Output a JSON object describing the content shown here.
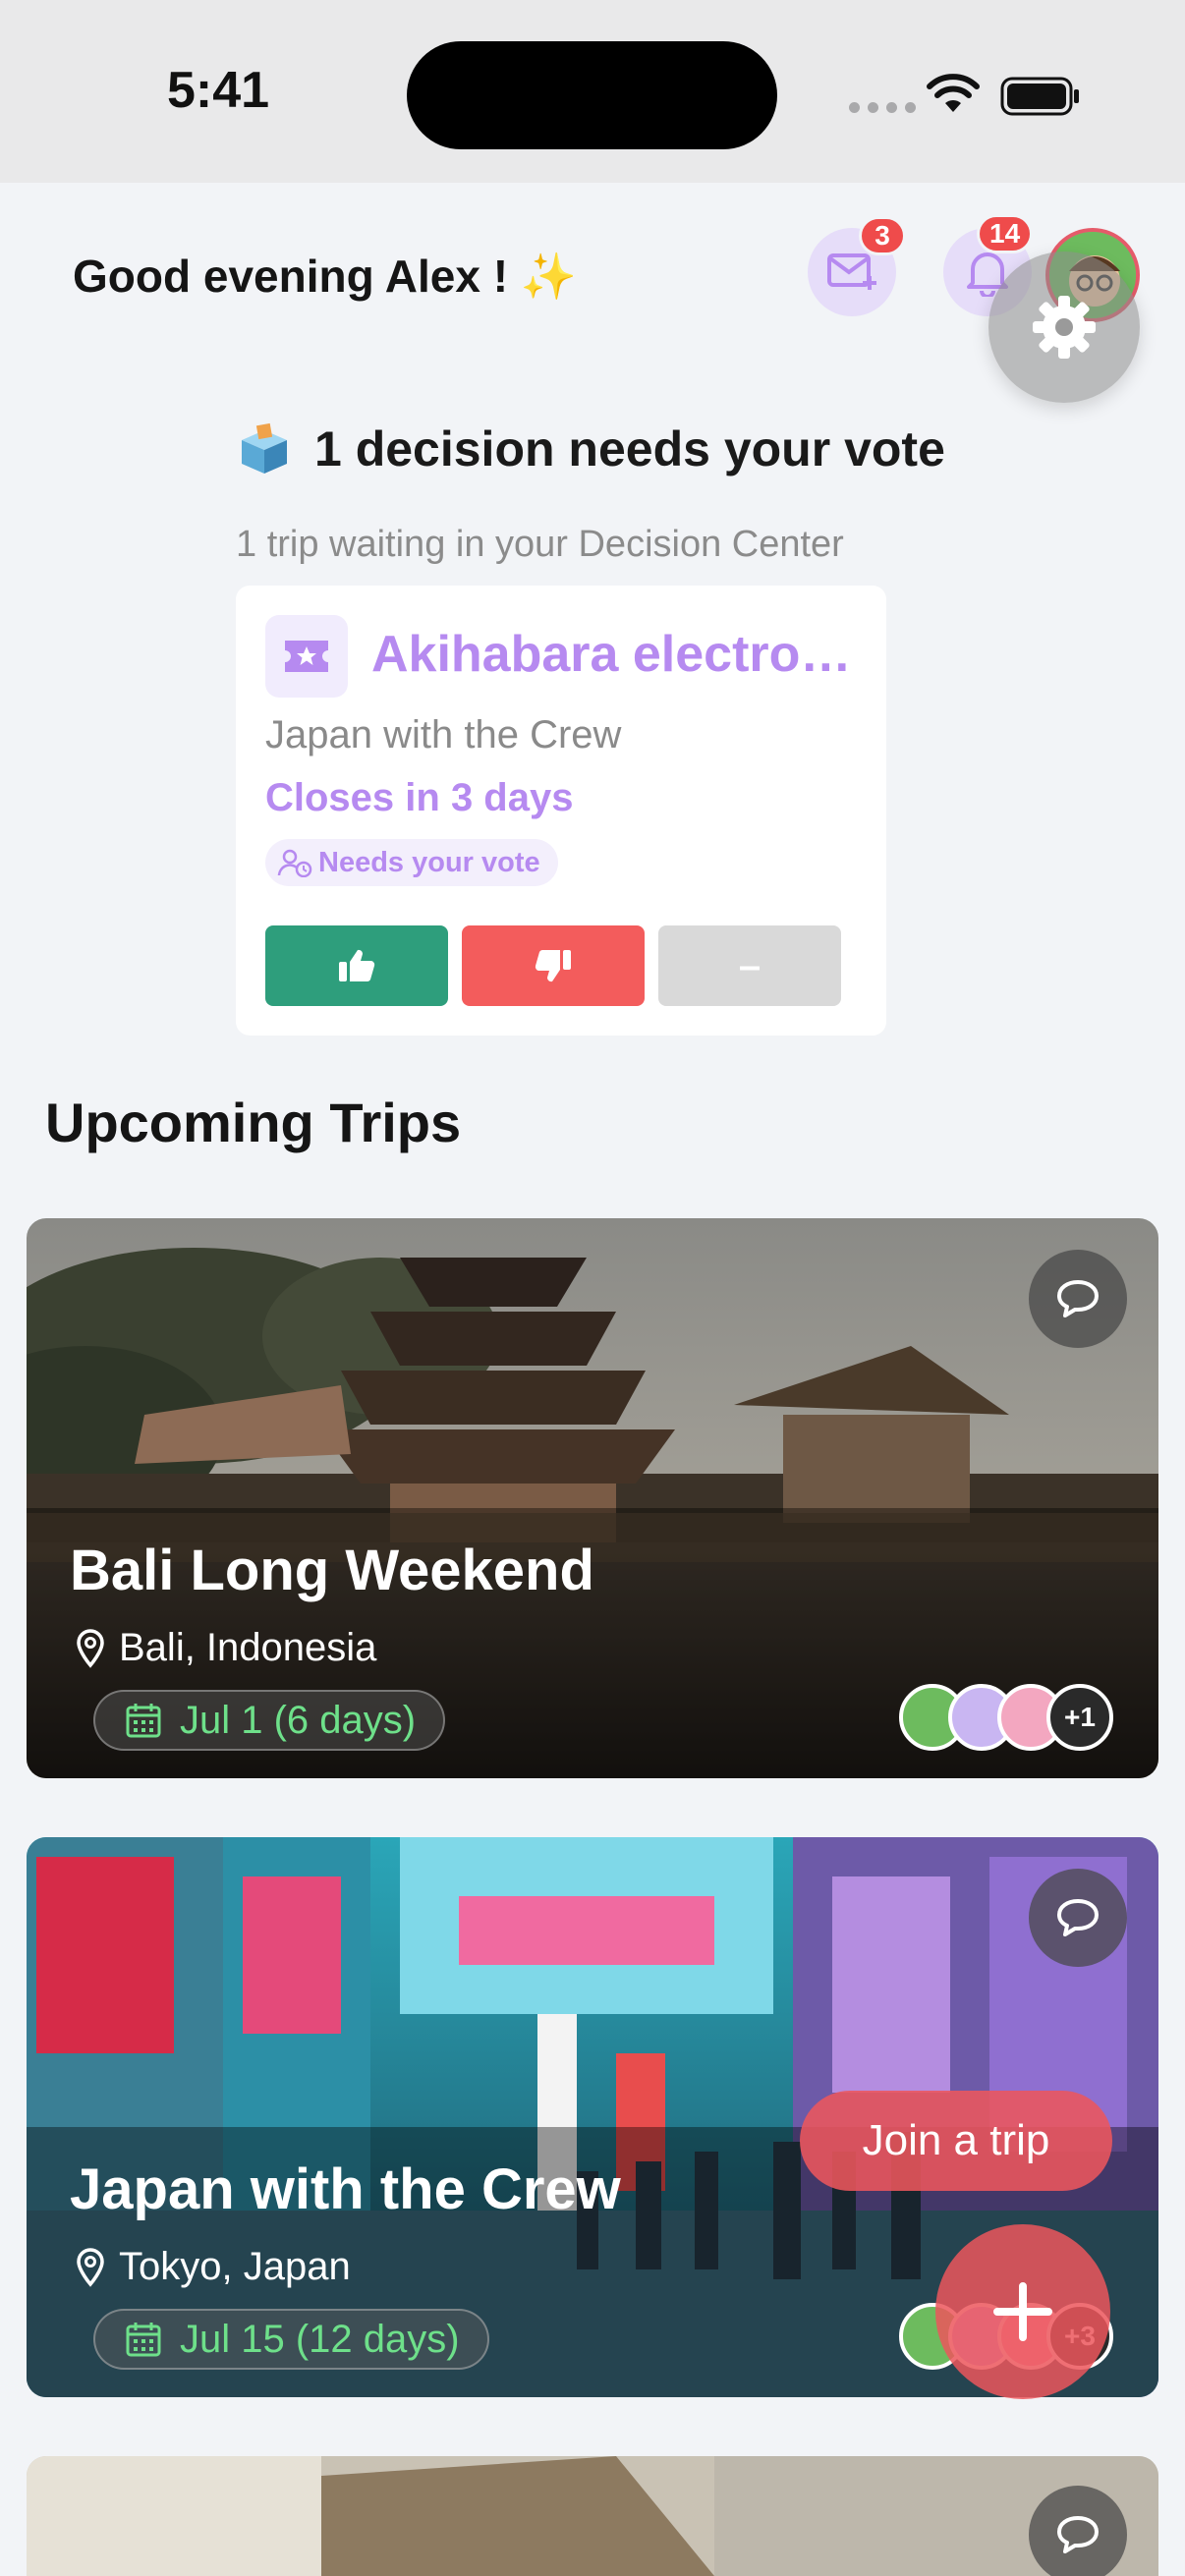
{
  "status_bar": {
    "time": "5:41"
  },
  "header": {
    "greeting": "Good evening Alex !",
    "greeting_emoji": "✨",
    "invites_badge": "3",
    "notifications_badge": "14"
  },
  "decision": {
    "title": "1 decision needs your vote",
    "subtitle": "1 trip waiting in your Decision Center",
    "card": {
      "title": "Akihabara electronics",
      "trip": "Japan with the Crew",
      "closes": "Closes in 3 days",
      "status_pill": "Needs your vote",
      "neutral_label": "–"
    }
  },
  "upcoming": {
    "title": "Upcoming Trips",
    "trips": [
      {
        "name": "Bali Long Weekend",
        "location": "Bali, Indonesia",
        "dates": "Jul 1 (6 days)",
        "extra_members": "+1"
      },
      {
        "name": "Japan with the Crew",
        "location": "Tokyo, Japan",
        "dates": "Jul 15 (12 days)",
        "extra_members": "+3"
      }
    ]
  },
  "fab": {
    "join_label": "Join a trip"
  },
  "colors": {
    "accent_purple": "#b68af0",
    "vote_up": "#2e9e7c",
    "vote_down": "#f35c5c",
    "badge_red": "#ef4b4b",
    "date_green": "#6ee08a"
  }
}
